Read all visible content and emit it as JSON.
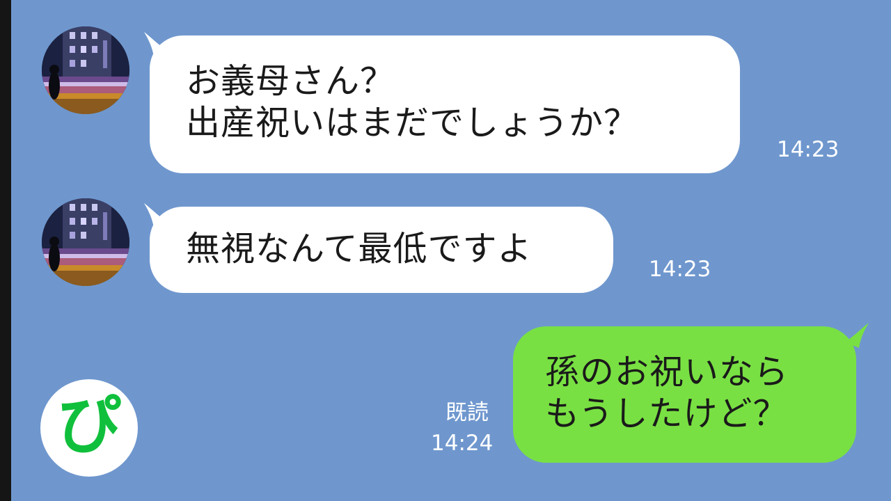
{
  "messages": [
    {
      "sender": "other",
      "lines": [
        "お義母さん？",
        "出産祝いはまだでしょうか？"
      ],
      "time": "14:23"
    },
    {
      "sender": "other",
      "lines": [
        "無視なんて最低ですよ"
      ],
      "time": "14:23"
    },
    {
      "sender": "me",
      "lines": [
        "孫のお祝いなら",
        "もうしたけど？"
      ],
      "read": "既読",
      "time": "14:24"
    }
  ],
  "logo": {
    "glyph": "ぴ"
  },
  "colors": {
    "background": "#6f97ce",
    "incoming_bubble": "#ffffff",
    "outgoing_bubble": "#79e043",
    "logo_green": "#10c03c"
  }
}
